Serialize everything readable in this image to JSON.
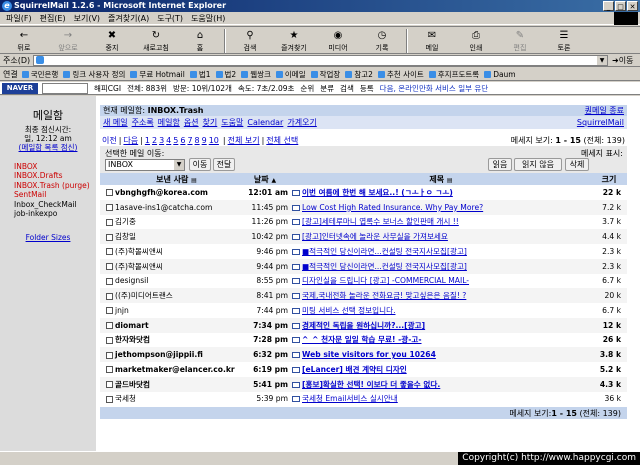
{
  "window": {
    "title": "SquirrelMail 1.2.6 - Microsoft Internet Explorer"
  },
  "menu": [
    "파일(F)",
    "편집(E)",
    "보기(V)",
    "즐겨찾기(A)",
    "도구(T)",
    "도움말(H)"
  ],
  "toolbar": [
    {
      "label": "뒤로",
      "icon": "←",
      "icon_name": "back-icon"
    },
    {
      "label": "앞으로",
      "icon": "→",
      "icon_name": "forward-icon"
    },
    {
      "label": "중지",
      "icon": "✖",
      "icon_name": "stop-icon"
    },
    {
      "label": "새로고침",
      "icon": "↻",
      "icon_name": "refresh-icon"
    },
    {
      "label": "홈",
      "icon": "⌂",
      "icon_name": "home-icon"
    },
    {
      "label": "검색",
      "icon": "⚲",
      "icon_name": "search-icon"
    },
    {
      "label": "즐겨찾기",
      "icon": "★",
      "icon_name": "favorites-icon"
    },
    {
      "label": "미디어",
      "icon": "◉",
      "icon_name": "media-icon"
    },
    {
      "label": "기록",
      "icon": "◷",
      "icon_name": "history-icon"
    },
    {
      "label": "메일",
      "icon": "✉",
      "icon_name": "mail-icon"
    },
    {
      "label": "인쇄",
      "icon": "⎙",
      "icon_name": "print-icon"
    },
    {
      "label": "편집",
      "icon": "✎",
      "icon_name": "edit-icon"
    },
    {
      "label": "토론",
      "icon": "☰",
      "icon_name": "discuss-icon"
    }
  ],
  "address": {
    "label": "주소(D)",
    "value": "",
    "go_label": "이동"
  },
  "links": {
    "label": "연결",
    "items": [
      "국민은행",
      "링크 사용자 정의",
      "무료 Hotmail",
      "법1",
      "법2",
      "웹쌍크",
      "이메일",
      "작업장",
      "참고2",
      "추천 사이트",
      "후지프도트록",
      "Daum"
    ]
  },
  "naver": {
    "logo": "NAVER",
    "items": [
      "해피CGI",
      "전체: 883위",
      "방문: 10위/102개",
      "속도: 7초/2.09초",
      "순위",
      "분류",
      "검색",
      "등록"
    ],
    "promo": "다음, 온라인만화 서비스 일부 유단"
  },
  "sidebar": {
    "title": "메일함",
    "check_label": "최종 점신시간:",
    "check_time": "일, 12:12 am",
    "refresh_link": "(메일함 목록 점신)",
    "folders": [
      {
        "name": "INBOX",
        "unread": true
      },
      {
        "name": "INBOX.Drafts",
        "unread": true
      },
      {
        "name": "INBOX.Trash",
        "unread": true,
        "suffix": " (purge)"
      },
      {
        "name": "SentMail",
        "unread": true
      },
      {
        "name": "Inbox_CheckMail",
        "unread": false
      },
      {
        "name": "job-inkexpo",
        "unread": false
      }
    ],
    "folder_sizes": "Folder Sizes"
  },
  "main": {
    "current_label": "현재 메일함:",
    "current_folder": "INBOX.Trash",
    "signout": "퀀메일 종료",
    "nav": [
      "새 메일",
      "주소록",
      "메일함",
      "옵션",
      "찾기",
      "도움말",
      "Calendar",
      "가계오기"
    ],
    "brand": "SquirrelMail",
    "pager": {
      "prev": "이전",
      "next": "다음",
      "pages": [
        "1",
        "2",
        "3",
        "4",
        "5",
        "6",
        "7",
        "8",
        "9",
        "10"
      ],
      "all": "전체 보기",
      "select_all": "전체 선택",
      "status_label": "메세지 보기: ",
      "range": "1 - 15",
      "total": "(전체: 139)"
    },
    "move": {
      "label": "선택한 메일 이동:",
      "selected": "INBOX",
      "move_btn": "이동",
      "forward_btn": "전달",
      "mark_label": "메세지 표시:",
      "read_btn": "읽음",
      "unread_btn": "읽지 않음",
      "delete_btn": "삭제"
    },
    "columns": {
      "from": "보낸 사람",
      "date": "날짜",
      "subject": "제목",
      "size": "크기"
    },
    "messages": [
      {
        "from": "vbnghgfh@korea.com",
        "date": "12:01 am",
        "subject": "이번 여름에 한번 해 보세요..! (ㄱㅗㅏㅇ ㄱㅗ)",
        "size": "22 k",
        "unread": true
      },
      {
        "from": "1asave-ins1@catcha.com",
        "date": "11:45 pm",
        "subject": "Low Cost High Rated Insurance. Why Pay More?",
        "size": "7.2 k",
        "unread": false
      },
      {
        "from": "김기중",
        "date": "11:26 pm",
        "subject": "[광고]세테루마니 엽록수 보너스 할인판매 개시 !!",
        "size": "3.7 k",
        "unread": false
      },
      {
        "from": "김창일",
        "date": "10:42 pm",
        "subject": "[광고]인터넷속에 놀라운 사무실을 가져보세요",
        "size": "4.4 k",
        "unread": false
      },
      {
        "from": "(주)학몰씨앤씨",
        "date": "9:46 pm",
        "subject": "■적극적인 당신이라면...컨설팅 전국지사모집[광고]",
        "size": "2.3 k",
        "unread": false
      },
      {
        "from": "(주)학몰씨앤씨",
        "date": "9:44 pm",
        "subject": "■적극적인 당신이라면...컨설팅 전국지사모집[광고]",
        "size": "2.3 k",
        "unread": false
      },
      {
        "from": "designsil",
        "date": "8:55 pm",
        "subject": "디자인실을 드립니다 [광고] -COMMERCIAL MAIL-",
        "size": "6.7 k",
        "unread": false
      },
      {
        "from": "((주)미디어트랜스",
        "date": "8:41 pm",
        "subject": "국제,국내전화 놀라운 전화요금! 맞고싶은은 음질! ?",
        "size": "20 k",
        "unread": false
      },
      {
        "from": "jnjn",
        "date": "7:44 pm",
        "subject": "미팅 서비스 선택 정보입니다.",
        "size": "6.7 k",
        "unread": false
      },
      {
        "from": "diomart",
        "date": "7:34 pm",
        "subject": "경제적인 독립을 원하십니까?...[광고]",
        "size": "12 k",
        "unread": true
      },
      {
        "from": "한자와닷컴",
        "date": "7:28 pm",
        "subject": "^_^ 천자문 일일 학습 무료! -광-고-",
        "size": "26 k",
        "unread": true
      },
      {
        "from": "jethompson@jippii.fi",
        "date": "6:32 pm",
        "subject": "Web site visitors for you 10264",
        "size": "3.8 k",
        "unread": true
      },
      {
        "from": "marketmaker@elancer.co.kr",
        "date": "6:19 pm",
        "subject": "[eLancer] 배견 계약티 디자인",
        "size": "5.2 k",
        "unread": true
      },
      {
        "from": "골드바닷컴",
        "date": "5:41 pm",
        "subject": "[홍보]확실한 선택! 이보다 더 좋을수 없다.",
        "size": "4.3 k",
        "unread": true
      },
      {
        "from": "국세청",
        "date": "5:39 pm",
        "subject": "국세청 Email서비스 실시안내",
        "size": "36 k",
        "unread": false
      }
    ]
  },
  "copyright": "Copyright(c) http://www.happycgi.com"
}
